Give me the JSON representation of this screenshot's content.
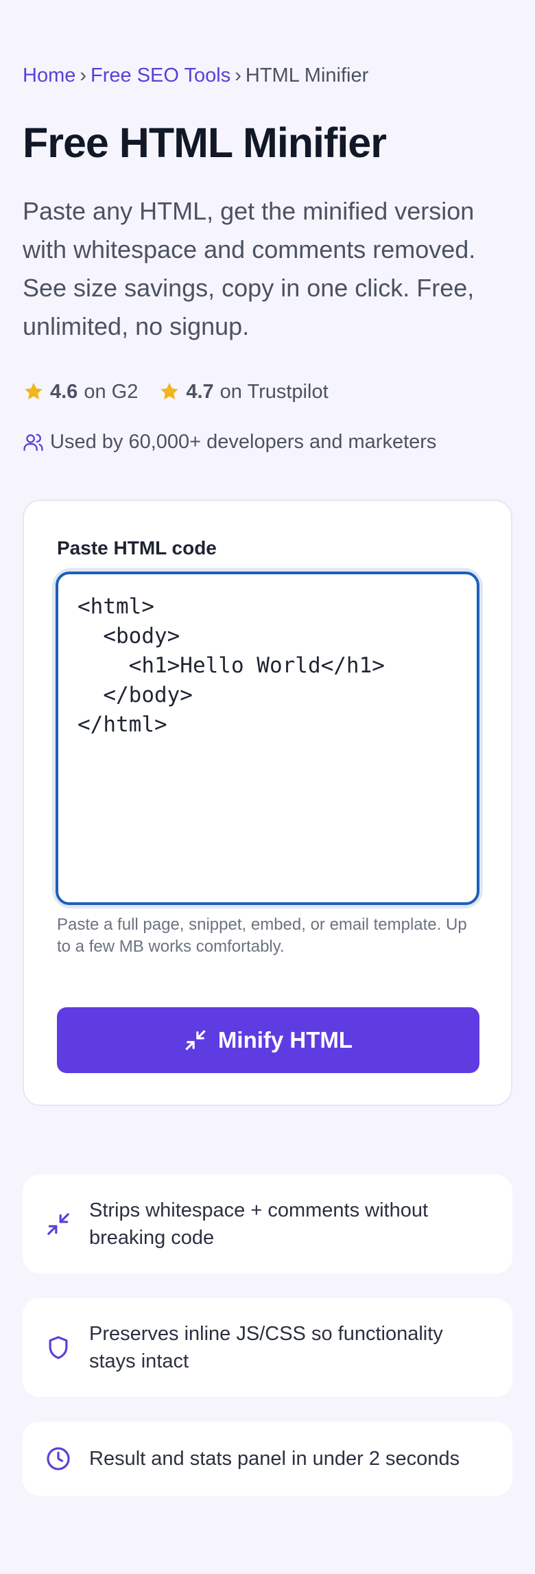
{
  "breadcrumb": {
    "items": [
      "Home",
      "Free SEO Tools",
      "HTML Minifier"
    ],
    "separator": "›"
  },
  "title": "Free HTML Minifier",
  "lead": "Paste any HTML, get the minified version with whitespace and comments removed. See size savings, copy in one click. Free, unlimited, no signup.",
  "ratings": [
    {
      "score": "4.6",
      "source": "on G2",
      "icon": "star-icon"
    },
    {
      "score": "4.7",
      "source": "on Trustpilot",
      "icon": "star-icon"
    }
  ],
  "users_text": "Used by 60,000+ developers and marketers",
  "form": {
    "label": "Paste HTML code",
    "value": "<html>\n  <body>\n    <h1>Hello World</h1>\n  </body>\n</html>",
    "hint": "Paste a full page, snippet, embed, or email template. Up to a few MB works comfortably.",
    "button_label": "Minify HTML",
    "button_icon": "minimize-icon"
  },
  "features": [
    {
      "icon": "minimize-icon",
      "text": "Strips whitespace + comments without breaking code"
    },
    {
      "icon": "shield-icon",
      "text": "Preserves inline JS/CSS so functionality stays intact"
    },
    {
      "icon": "clock-icon",
      "text": "Result and stats panel in under 2 seconds"
    }
  ],
  "colors": {
    "accent": "#5f3ce2",
    "link": "#5a3fd6",
    "star": "#f2b51c",
    "focus_border": "#1d5fb6",
    "background": "#f6f5fd"
  }
}
